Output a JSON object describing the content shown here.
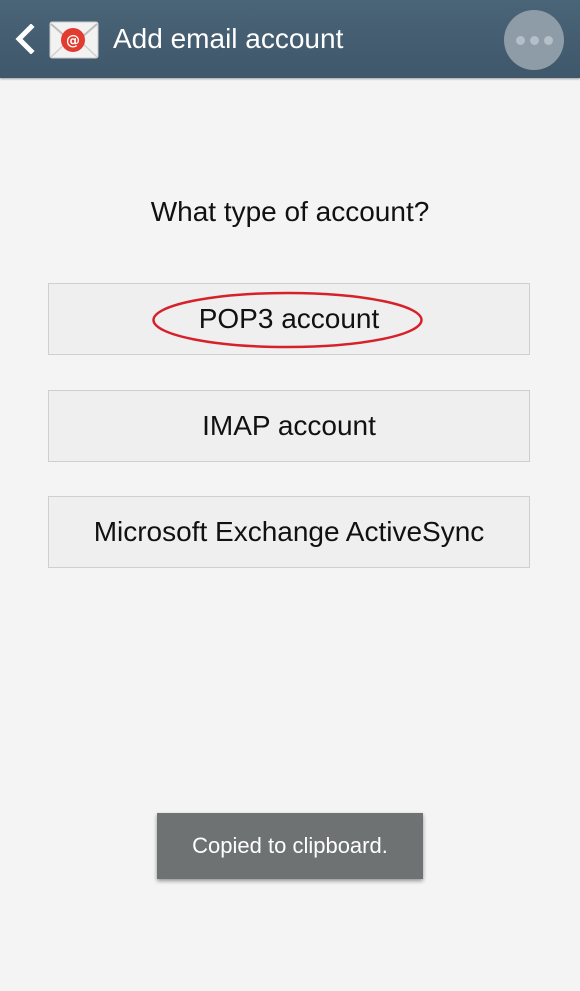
{
  "action_bar": {
    "title": "Add email account",
    "back_icon": "chevron-left-icon",
    "app_icon": "email-app-icon",
    "overflow_icon": "more-options-icon",
    "background_color": "#46606f"
  },
  "content": {
    "question": "What type of account?",
    "options": [
      {
        "label": "POP3 account",
        "highlighted": true
      },
      {
        "label": "IMAP account",
        "highlighted": false
      },
      {
        "label": "Microsoft Exchange ActiveSync",
        "highlighted": false
      }
    ],
    "highlight_color": "#d6212b"
  },
  "toast": {
    "message": "Copied to clipboard."
  }
}
